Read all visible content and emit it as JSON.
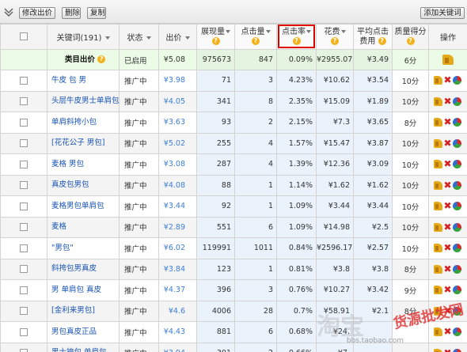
{
  "toolbar": {
    "modify_price": "修改出价",
    "delete": "删除",
    "copy": "复制",
    "add_keyword": "添加关键词"
  },
  "columns": {
    "keyword": "关键词(191)",
    "status": "状态",
    "price": "出价",
    "impressions": "展现量",
    "clicks": "点击量",
    "ctr": "点击率",
    "cost": "花费",
    "avg_cpc_1": "平均点击",
    "avg_cpc_2": "费用",
    "quality": "质量得分",
    "action": "操作"
  },
  "category_row": {
    "keyword": "类目出价",
    "status": "已启用",
    "price": "¥5.08",
    "impressions": "975673",
    "clicks": "847",
    "ctr": "0.09%",
    "cost": "¥2955.07",
    "avg_cpc": "¥3.49",
    "quality": "6分"
  },
  "rows": [
    {
      "keyword": "牛皮 包 男",
      "status": "推广中",
      "price": "¥3.98",
      "impressions": "71",
      "clicks": "3",
      "ctr": "4.23%",
      "cost": "¥10.62",
      "avg_cpc": "¥3.54",
      "quality": "10分"
    },
    {
      "keyword": "头层牛皮男士单肩包",
      "status": "推广中",
      "price": "¥4.05",
      "impressions": "341",
      "clicks": "8",
      "ctr": "2.35%",
      "cost": "¥15.09",
      "avg_cpc": "¥1.89",
      "quality": "10分"
    },
    {
      "keyword": "单肩斜挎小包",
      "status": "推广中",
      "price": "¥3.63",
      "impressions": "93",
      "clicks": "2",
      "ctr": "2.15%",
      "cost": "¥7.3",
      "avg_cpc": "¥3.65",
      "quality": "8分"
    },
    {
      "keyword": "[花花公子 男包]",
      "status": "推广中",
      "price": "¥5.02",
      "impressions": "255",
      "clicks": "4",
      "ctr": "1.57%",
      "cost": "¥15.47",
      "avg_cpc": "¥3.87",
      "quality": "10分"
    },
    {
      "keyword": "麦格 男包",
      "status": "推广中",
      "price": "¥3.08",
      "impressions": "287",
      "clicks": "4",
      "ctr": "1.39%",
      "cost": "¥12.36",
      "avg_cpc": "¥3.09",
      "quality": "10分"
    },
    {
      "keyword": "真皮包男包",
      "status": "推广中",
      "price": "¥4.08",
      "impressions": "88",
      "clicks": "1",
      "ctr": "1.14%",
      "cost": "¥1.62",
      "avg_cpc": "¥1.62",
      "quality": "10分"
    },
    {
      "keyword": "麦格男包单肩包",
      "status": "推广中",
      "price": "¥3.44",
      "impressions": "92",
      "clicks": "1",
      "ctr": "1.09%",
      "cost": "¥3.44",
      "avg_cpc": "¥3.44",
      "quality": "10分"
    },
    {
      "keyword": "麦格",
      "status": "推广中",
      "price": "¥2.89",
      "impressions": "551",
      "clicks": "6",
      "ctr": "1.09%",
      "cost": "¥14.98",
      "avg_cpc": "¥2.5",
      "quality": "10分"
    },
    {
      "keyword": "\"男包\"",
      "status": "推广中",
      "price": "¥6.02",
      "impressions": "119991",
      "clicks": "1011",
      "ctr": "0.84%",
      "cost": "¥2596.17",
      "avg_cpc": "¥2.57",
      "quality": "10分"
    },
    {
      "keyword": "斜挎包男真皮",
      "status": "推广中",
      "price": "¥3.84",
      "impressions": "123",
      "clicks": "1",
      "ctr": "0.81%",
      "cost": "¥3.8",
      "avg_cpc": "¥3.8",
      "quality": "8分"
    },
    {
      "keyword": "男 单肩包 真皮",
      "status": "推广中",
      "price": "¥4.37",
      "impressions": "396",
      "clicks": "3",
      "ctr": "0.76%",
      "cost": "¥10.27",
      "avg_cpc": "¥3.42",
      "quality": "9分"
    },
    {
      "keyword": "[金利来男包]",
      "status": "推广中",
      "price": "¥4.6",
      "impressions": "4006",
      "clicks": "28",
      "ctr": "0.7%",
      "cost": "¥58.91",
      "avg_cpc": "¥2.1",
      "quality": "8分"
    },
    {
      "keyword": "男包真皮正品",
      "status": "推广中",
      "price": "¥4.43",
      "impressions": "881",
      "clicks": "6",
      "ctr": "0.68%",
      "cost": "¥24.",
      "avg_cpc": "",
      "quality": ""
    },
    {
      "keyword": "男士挎包 单肩包",
      "status": "推广中",
      "price": "¥3.94",
      "impressions": "301",
      "clicks": "2",
      "ctr": "0.66%",
      "cost": "¥7.",
      "avg_cpc": "",
      "quality": ""
    }
  ],
  "watermark": {
    "site": "货源批发网",
    "logo": "淘宝",
    "url": "bbs.taobao.com"
  },
  "icons": [
    "collapse-arrow-icon",
    "help-icon",
    "sort-icon",
    "bid-thumb-icon",
    "delete-x-icon",
    "report-pie-icon"
  ],
  "colors": {
    "accent_red": "#e00000",
    "link_blue": "#1a55b5",
    "category_green": "#ecfbe6"
  }
}
